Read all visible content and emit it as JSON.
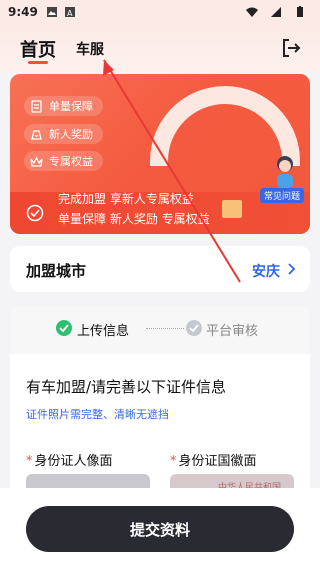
{
  "status_bar": {
    "time": "9:49"
  },
  "header": {
    "tabs": [
      {
        "label": "首页",
        "active": true
      },
      {
        "label": "车服",
        "active": false
      }
    ]
  },
  "banner": {
    "pills": [
      "单量保障",
      "新人奖励",
      "专属权益"
    ],
    "line1": "完成加盟 享新人专属权益",
    "line2": "单量保障 新人奖励 专属权益",
    "faq": "常见问题"
  },
  "city": {
    "title": "加盟城市",
    "value": "安庆"
  },
  "steps": [
    {
      "label": "上传信息",
      "done": true
    },
    {
      "label": "平台审核",
      "done": false
    }
  ],
  "documents": {
    "title": "有车加盟/请完善以下证件信息",
    "hint": "证件照片需完整、清晰无遮挡",
    "uploads": [
      {
        "label": "身份证人像面"
      },
      {
        "label": "身份证国徽面",
        "watermark": "中华人民共和国"
      }
    ]
  },
  "submit": {
    "label": "提交资料"
  },
  "colors": {
    "accent": "#f0503c",
    "link": "#2f66e6",
    "primary_button": "#2a2a33"
  }
}
